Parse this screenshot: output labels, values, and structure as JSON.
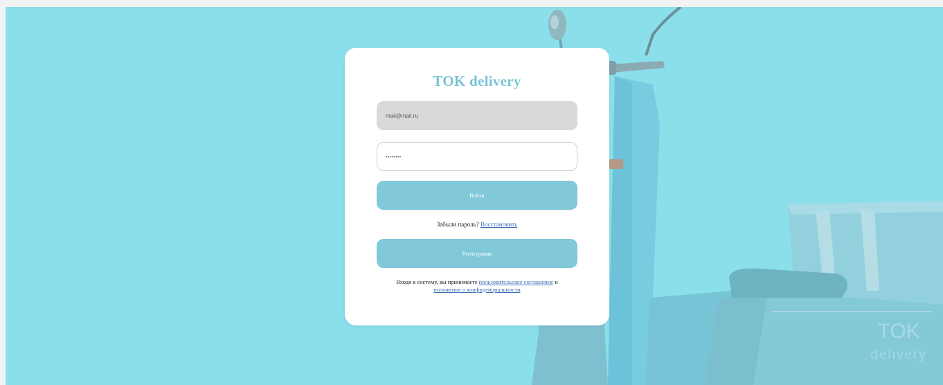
{
  "brand": {
    "title": "TOK delivery",
    "watermark_line1": "TOK",
    "watermark_line2": "delivery"
  },
  "form": {
    "email_value": "mail@mail.ru",
    "password_value": "••••••••",
    "login_label": "Войти",
    "forgot_text": "Забыли пароль?",
    "forgot_link": "Восстановить",
    "register_label": "Регистрация",
    "terms_prefix": "Входя в систему, вы принимаете",
    "terms_link1": "пользовательское соглашение",
    "terms_and": "и",
    "terms_link2": "положение о конфиденциальности"
  },
  "colors": {
    "background": "#8adfea",
    "card": "#ffffff",
    "accent": "#80c8da",
    "title": "#7cc3d7",
    "link": "#3d6db8"
  }
}
